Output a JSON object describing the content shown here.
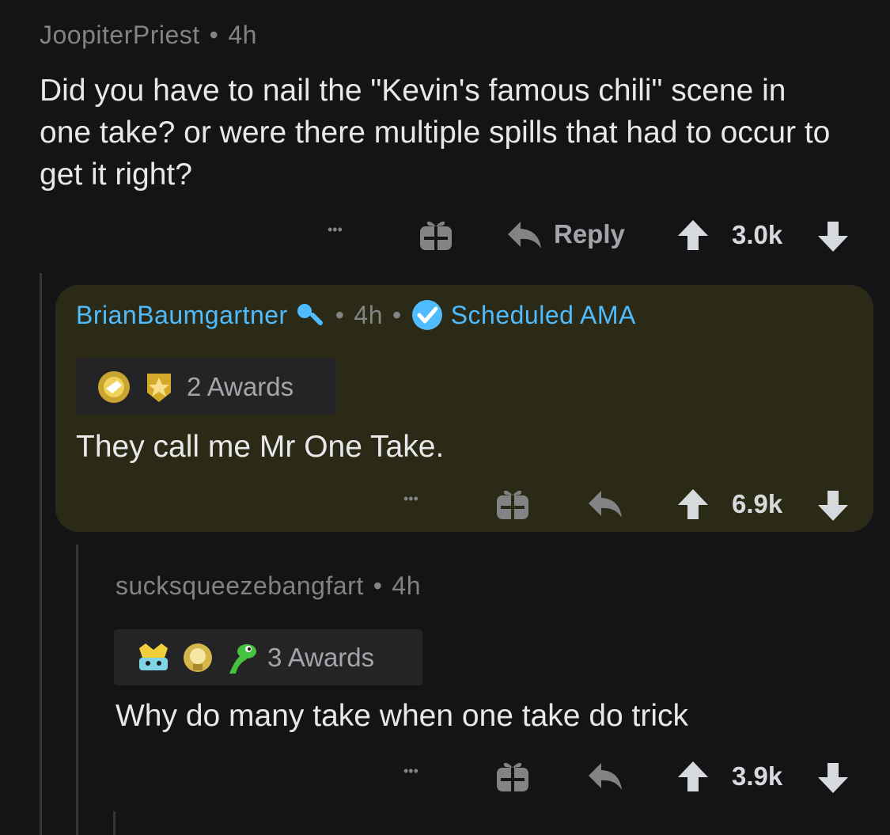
{
  "comments": [
    {
      "username": "JoopiterPriest",
      "age": "4h",
      "body": "Did you have to nail the \"Kevin's famous chili\" scene in one take? or were there multiple spills that had to occur to get it right?",
      "reply_label": "Reply",
      "score": "3.0k"
    },
    {
      "username": "BrianBaumgartner",
      "age": "4h",
      "flair": "Scheduled AMA",
      "awards": "2 Awards",
      "body": "They call me Mr One Take.",
      "score": "6.9k"
    },
    {
      "username": "sucksqueezebangfart",
      "age": "4h",
      "awards": "3 Awards",
      "body": "Why do many take when one take do trick",
      "score": "3.9k"
    }
  ],
  "separator": "•",
  "more_label": "•••",
  "colors": {
    "background": "#141416",
    "op_highlight": "#2b2a16",
    "op_username": "#4fbcff",
    "muted": "#818384"
  },
  "icons": [
    "more-icon",
    "gift-icon",
    "reply-icon",
    "upvote-icon",
    "downvote-icon",
    "microphone-icon",
    "verified-check-icon",
    "award-icon"
  ]
}
